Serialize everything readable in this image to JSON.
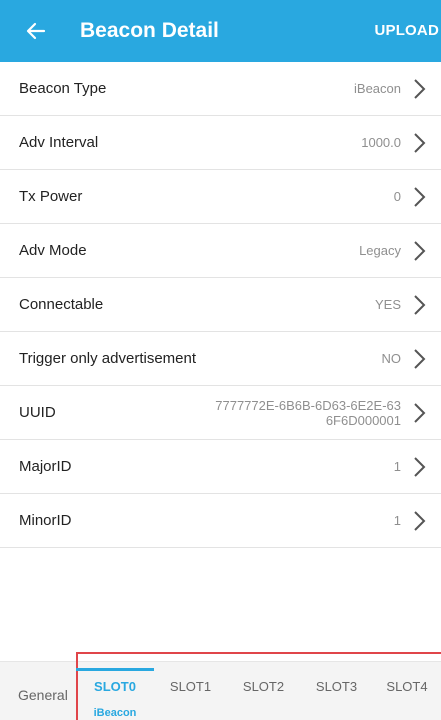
{
  "header": {
    "title": "Beacon Detail",
    "action": "UPLOAD"
  },
  "rows": [
    {
      "label": "Beacon Type",
      "value": "iBeacon"
    },
    {
      "label": "Adv Interval",
      "value": "1000.0"
    },
    {
      "label": "Tx Power",
      "value": "0"
    },
    {
      "label": "Adv Mode",
      "value": "Legacy"
    },
    {
      "label": "Connectable",
      "value": "YES"
    },
    {
      "label": "Trigger only advertisement",
      "value": "NO"
    },
    {
      "label": "UUID",
      "value": "7777772E-6B6B-6D63-6E2E-636F6D000001"
    },
    {
      "label": "MajorID",
      "value": "1"
    },
    {
      "label": "MinorID",
      "value": "1"
    }
  ],
  "bottom": {
    "general": "General",
    "slots": [
      {
        "label": "SLOT0",
        "sub": "iBeacon"
      },
      {
        "label": "SLOT1"
      },
      {
        "label": "SLOT2"
      },
      {
        "label": "SLOT3"
      },
      {
        "label": "SLOT4"
      }
    ]
  },
  "colors": {
    "accent": "#29a8e0",
    "highlight_box": "#e0454a"
  }
}
